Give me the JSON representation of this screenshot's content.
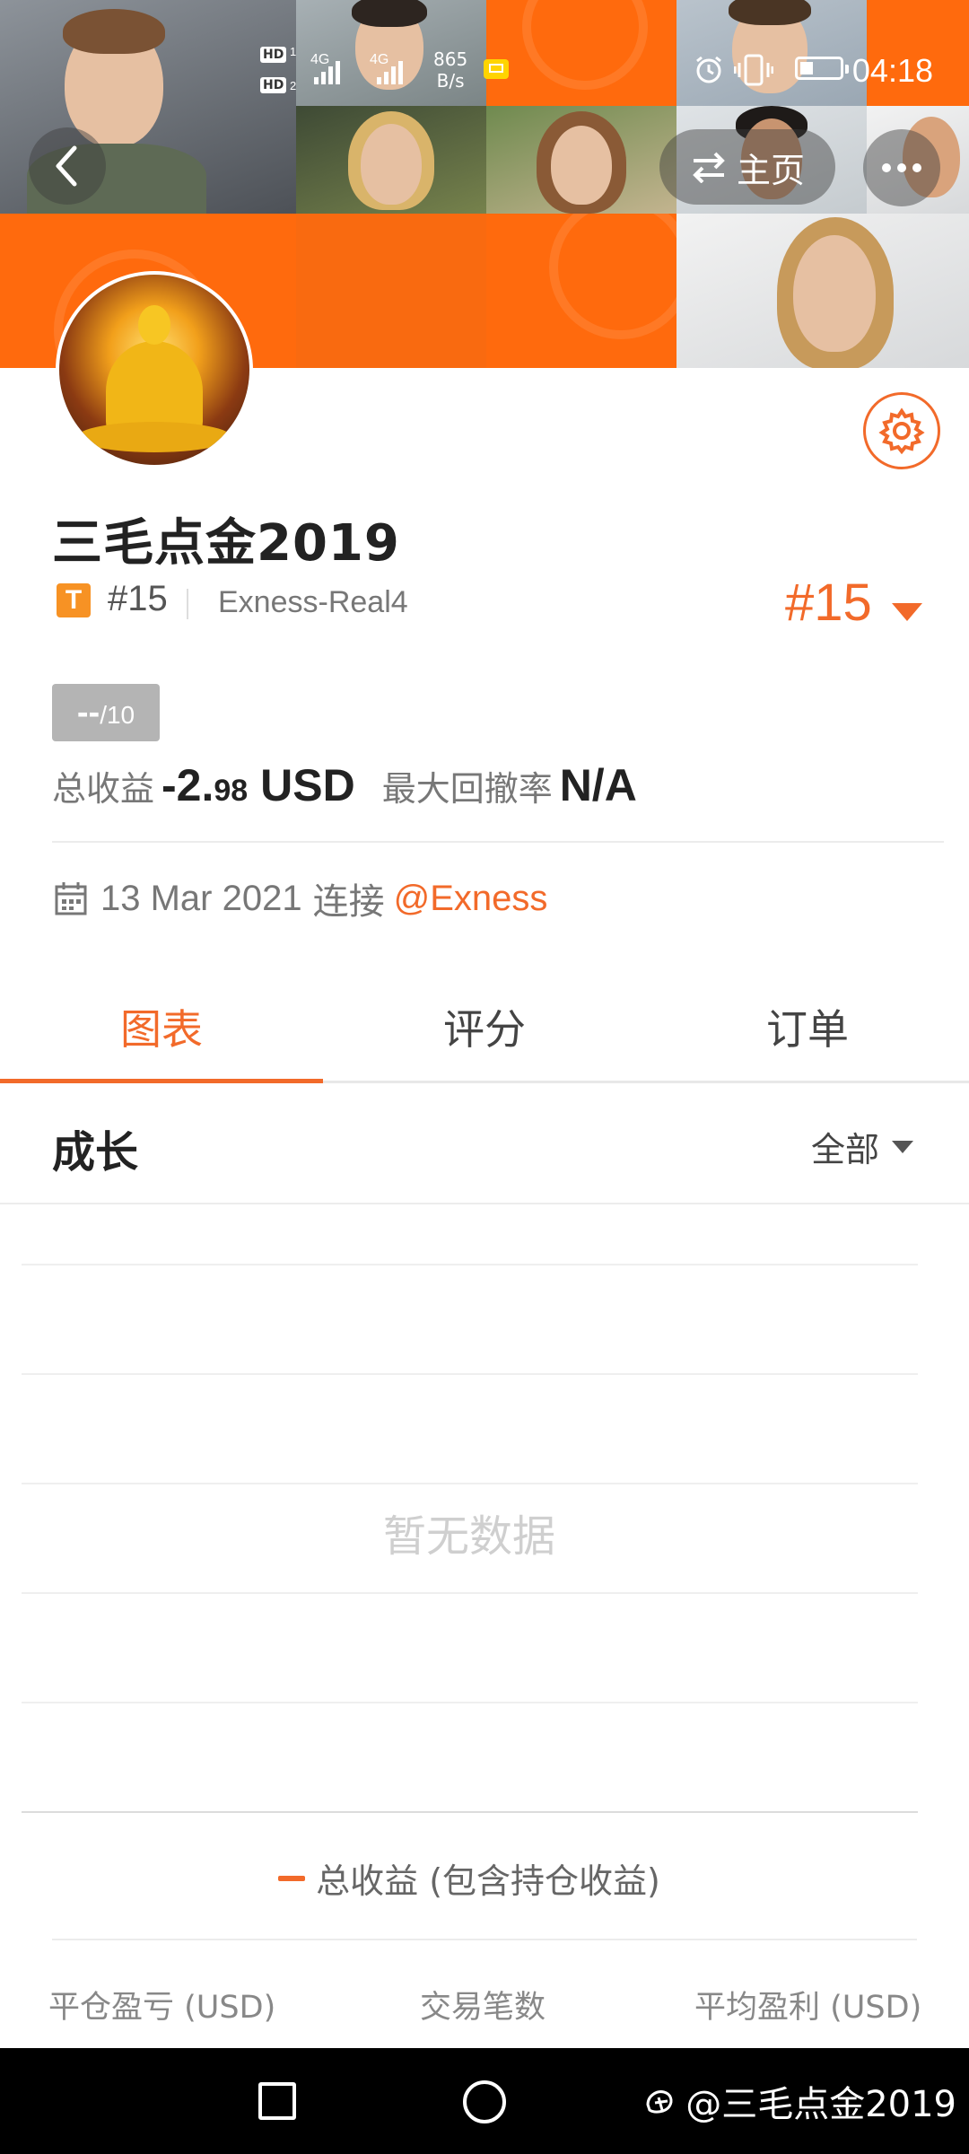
{
  "status_bar": {
    "hd_label": "HD",
    "sim1": "1",
    "sim2": "2",
    "net1": "4G",
    "net2": "4G",
    "speed_value": "865",
    "speed_unit": "B/s",
    "time": "04:18"
  },
  "header": {
    "home_label": "主页"
  },
  "profile": {
    "name": "三毛点金2019",
    "tier_badge": "T",
    "rank_small": "#15",
    "account": "Exness-Real4",
    "rank_big": "#15",
    "score_value": "--",
    "score_max": "/10",
    "total_return_label": "总收益",
    "total_return_value_main": "-2.",
    "total_return_value_decimal": "98",
    "total_return_currency": "USD",
    "max_drawdown_label": "最大回撤率",
    "max_drawdown_value": "N/A",
    "date": "13 Mar 2021",
    "connect_label": "连接",
    "broker": "@Exness"
  },
  "tabs": [
    {
      "label": "图表",
      "active": true
    },
    {
      "label": "评分",
      "active": false
    },
    {
      "label": "订单",
      "active": false
    }
  ],
  "chart_section": {
    "title": "成长",
    "filter_label": "全部",
    "empty_text": "暂无数据",
    "legend_label": "总收益 (包含持仓收益)"
  },
  "chart_data": {
    "type": "line",
    "title": "",
    "series": [],
    "legend": [
      "总收益 (包含持仓收益)"
    ],
    "empty_message": "暂无数据",
    "grid": true
  },
  "stats_columns": [
    "平仓盈亏 (USD)",
    "交易笔数",
    "平均盈利 (USD)"
  ],
  "watermark": "@三毛点金2019",
  "colors": {
    "accent": "#f26a2a",
    "banner_orange": "#ff6a0d",
    "score_gray": "#b4b4b4"
  },
  "icons": [
    "back-arrow-icon",
    "swap-arrows-icon",
    "more-dots-icon",
    "gear-icon",
    "calendar-icon",
    "dropdown-caret-icon",
    "alarm-icon",
    "vibrate-icon",
    "battery-icon",
    "signal-icon",
    "nav-square-icon",
    "nav-circle-icon"
  ]
}
